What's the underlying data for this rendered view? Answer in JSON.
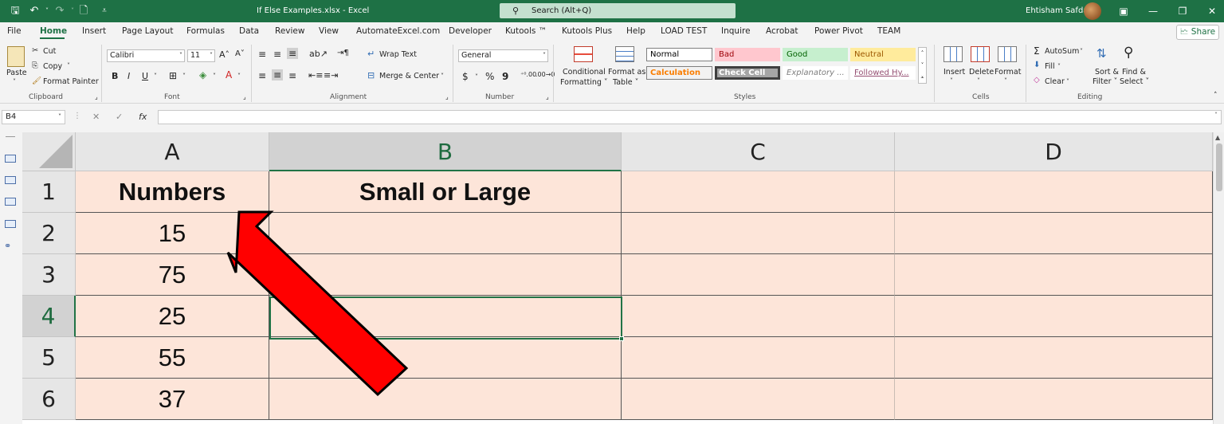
{
  "titlebar": {
    "doc_title": "If Else Examples.xlsx  -  Excel",
    "search_placeholder": "Search (Alt+Q)",
    "user_name": "Ehtisham Safdar",
    "qa_save": "🖫",
    "qa_undo": "↶",
    "qa_redo": "↷",
    "qa_new": "🗋",
    "qa_more": "⩡",
    "win_ribbon": "▣",
    "win_min": "—",
    "win_max": "❐",
    "win_close": "✕"
  },
  "menu": {
    "tabs": [
      "File",
      "Home",
      "Insert",
      "Page Layout",
      "Formulas",
      "Data",
      "Review",
      "View",
      "AutomateExcel.com",
      "Developer",
      "Kutools ™",
      "Kutools Plus",
      "Help",
      "LOAD TEST",
      "Inquire",
      "Acrobat",
      "Power Pivot",
      "TEAM"
    ],
    "active_tab": "Home",
    "share_label": "🗠 Share"
  },
  "ribbon": {
    "clipboard": {
      "paste": "Paste",
      "cut": "Cut",
      "copy": "Copy",
      "format_painter": "Format Painter",
      "label": "Clipboard"
    },
    "font": {
      "family": "Calibri",
      "size": "11",
      "grow": "A˄",
      "shrink": "A˅",
      "bold": "B",
      "italic": "I",
      "underline": "U",
      "label": "Font"
    },
    "alignment": {
      "wrap_text": "Wrap Text",
      "merge_center": "Merge & Center",
      "label": "Alignment"
    },
    "number": {
      "format": "General",
      "currency": "$",
      "percent": "%",
      "comma": "9",
      "label": "Number"
    },
    "styles": {
      "conditional_formatting": [
        "Conditional",
        "Formatting ˅"
      ],
      "format_as_table": [
        "Format as",
        "Table ˅"
      ],
      "cells": [
        {
          "name": "Normal",
          "bg": "#ffffff",
          "fg": "#000000",
          "border": "#7f7f7f"
        },
        {
          "name": "Bad",
          "bg": "#ffc7ce",
          "fg": "#9c0006",
          "border": "#ffc7ce"
        },
        {
          "name": "Good",
          "bg": "#c6efce",
          "fg": "#006100",
          "border": "#c6efce"
        },
        {
          "name": "Neutral",
          "bg": "#ffeb9c",
          "fg": "#9c5700",
          "border": "#ffeb9c"
        },
        {
          "name": "Calculation",
          "bg": "#f2f2f2",
          "fg": "#fa7d00",
          "border": "#7f7f7f"
        },
        {
          "name": "Check Cell",
          "bg": "#a5a5a5",
          "fg": "#ffffff",
          "border": "#3f3f3f"
        },
        {
          "name": "Explanatory ...",
          "bg": "#ffffff",
          "fg": "#7f7f7f",
          "border": "#ffffff"
        },
        {
          "name": "Followed Hy...",
          "bg": "#ffffff",
          "fg": "#954f72",
          "border": "#ffffff"
        }
      ],
      "label": "Styles"
    },
    "cells_group": {
      "insert": "Insert",
      "delete": "Delete",
      "format": "Format",
      "label": "Cells"
    },
    "editing": {
      "autosum": "AutoSum",
      "fill": "Fill",
      "clear": "Clear",
      "sort_filter": [
        "Sort &",
        "Filter ˅"
      ],
      "find_select": [
        "Find &",
        "Select ˅"
      ],
      "label": "Editing"
    }
  },
  "formula_bar": {
    "name_box": "B4",
    "fx": "fx",
    "cancel": "✕",
    "enter": "✓",
    "value": ""
  },
  "sheet": {
    "columns": [
      "A",
      "B",
      "C",
      "D"
    ],
    "selected_column": "B",
    "selected_row": "4",
    "rows": [
      {
        "num": "1",
        "cells": [
          "Numbers",
          "Small or Large",
          "",
          ""
        ]
      },
      {
        "num": "2",
        "cells": [
          "15",
          "",
          "",
          ""
        ]
      },
      {
        "num": "3",
        "cells": [
          "75",
          "",
          "",
          ""
        ]
      },
      {
        "num": "4",
        "cells": [
          "25",
          "",
          "",
          ""
        ]
      },
      {
        "num": "5",
        "cells": [
          "55",
          "",
          "",
          ""
        ]
      },
      {
        "num": "6",
        "cells": [
          "37",
          "",
          "",
          ""
        ]
      }
    ],
    "fill_color": "#fde5d9"
  },
  "annotation": {
    "arrow_color": "#ff0000",
    "arrow_outline": "#000000"
  }
}
